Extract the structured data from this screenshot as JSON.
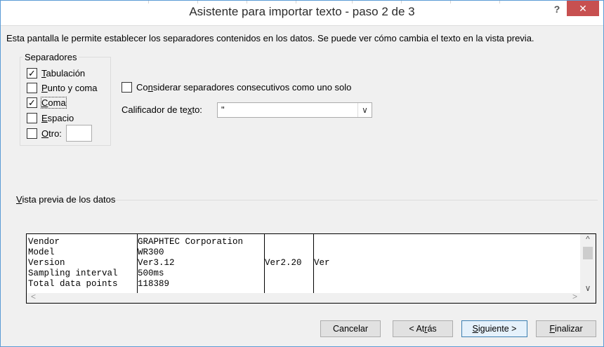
{
  "window": {
    "title": "Asistente para importar texto - paso 2 de 3",
    "help": "?",
    "close": "✕"
  },
  "intro": "Esta pantalla le permite establecer los separadores contenidos en los datos. Se puede ver cómo cambia el texto en la vista previa.",
  "separators": {
    "legend": "Separadores",
    "items": [
      {
        "pre": "",
        "accel": "T",
        "post": "abulación",
        "checked": true
      },
      {
        "pre": "",
        "accel": "P",
        "post": "unto y coma",
        "checked": false
      },
      {
        "pre": "",
        "accel": "C",
        "post": "oma",
        "checked": true
      },
      {
        "pre": "",
        "accel": "E",
        "post": "spacio",
        "checked": false
      },
      {
        "pre": "",
        "accel": "O",
        "post": "tro:",
        "checked": false
      }
    ]
  },
  "consecutive": {
    "pre": "Co",
    "accel": "n",
    "post": "siderar separadores consecutivos como uno solo",
    "checked": false
  },
  "qualifier": {
    "pre": "Calificador de te",
    "accel": "x",
    "post": "to:",
    "value": "\"",
    "arrow": "∨"
  },
  "preview": {
    "legend_accel": "V",
    "legend_rest": "ista previa de los datos",
    "columns": [
      [
        "Vendor",
        "Model",
        "Version",
        "Sampling interval",
        "Total data points"
      ],
      [
        "GRAPHTEC Corporation",
        "WR300",
        "Ver3.12",
        "500ms",
        "118389"
      ],
      [
        "",
        "",
        "Ver2.20",
        "",
        ""
      ],
      [
        "",
        "",
        "Ver",
        "",
        ""
      ]
    ],
    "scroll_up": "^",
    "scroll_down": "∨",
    "scroll_left": "<",
    "scroll_right": ">"
  },
  "buttons": {
    "cancel": "Cancelar",
    "back_pre": "< At",
    "back_accel": "r",
    "back_post": "ás",
    "next_accel": "S",
    "next_post": "iguiente >",
    "finish_accel": "F",
    "finish_post": "inalizar"
  },
  "colors": {
    "accent": "#5b9bd5",
    "close": "#c75050"
  }
}
